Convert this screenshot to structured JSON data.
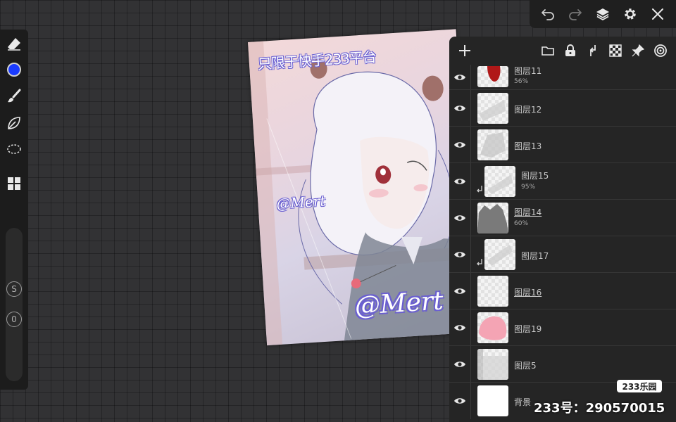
{
  "top_bar": {
    "icons": [
      "undo-icon",
      "redo-icon",
      "layers-icon",
      "settings-icon",
      "close-icon"
    ]
  },
  "left_toolbar": {
    "tools": [
      "eraser-icon",
      "color-picker",
      "brush-icon",
      "leaf-smudge-icon",
      "lasso-icon",
      "grid-icon"
    ],
    "current_color": "#1a3bff",
    "size_button": "S",
    "opacity_button": "0"
  },
  "artwork": {
    "title_text": "只限于快手233平台",
    "watermark_small": "@Mert",
    "watermark_large": "@Mert"
  },
  "layers_panel": {
    "toolbar_icons": [
      "add-layer-icon",
      "folder-icon",
      "lock-icon",
      "merge-down-icon",
      "transparency-icon",
      "pin-icon",
      "target-icon"
    ],
    "layers": [
      {
        "name": "图层11",
        "opacity": "56%",
        "clipped": false,
        "underlined": false
      },
      {
        "name": "图层12",
        "opacity": "",
        "clipped": false,
        "underlined": false
      },
      {
        "name": "图层13",
        "opacity": "",
        "clipped": false,
        "underlined": false
      },
      {
        "name": "图层15",
        "opacity": "95%",
        "clipped": true,
        "underlined": false
      },
      {
        "name": "图层14",
        "opacity": "60%",
        "clipped": false,
        "underlined": true
      },
      {
        "name": "图层17",
        "opacity": "",
        "clipped": true,
        "underlined": false
      },
      {
        "name": "图层16",
        "opacity": "",
        "clipped": false,
        "underlined": true
      },
      {
        "name": "图层19",
        "opacity": "",
        "clipped": false,
        "underlined": false
      },
      {
        "name": "图层5",
        "opacity": "",
        "clipped": false,
        "underlined": false
      },
      {
        "name": "背景",
        "opacity": "",
        "clipped": false,
        "underlined": false
      }
    ]
  },
  "overlay": {
    "badge": "233乐园",
    "id_label": "233号：290570015"
  }
}
